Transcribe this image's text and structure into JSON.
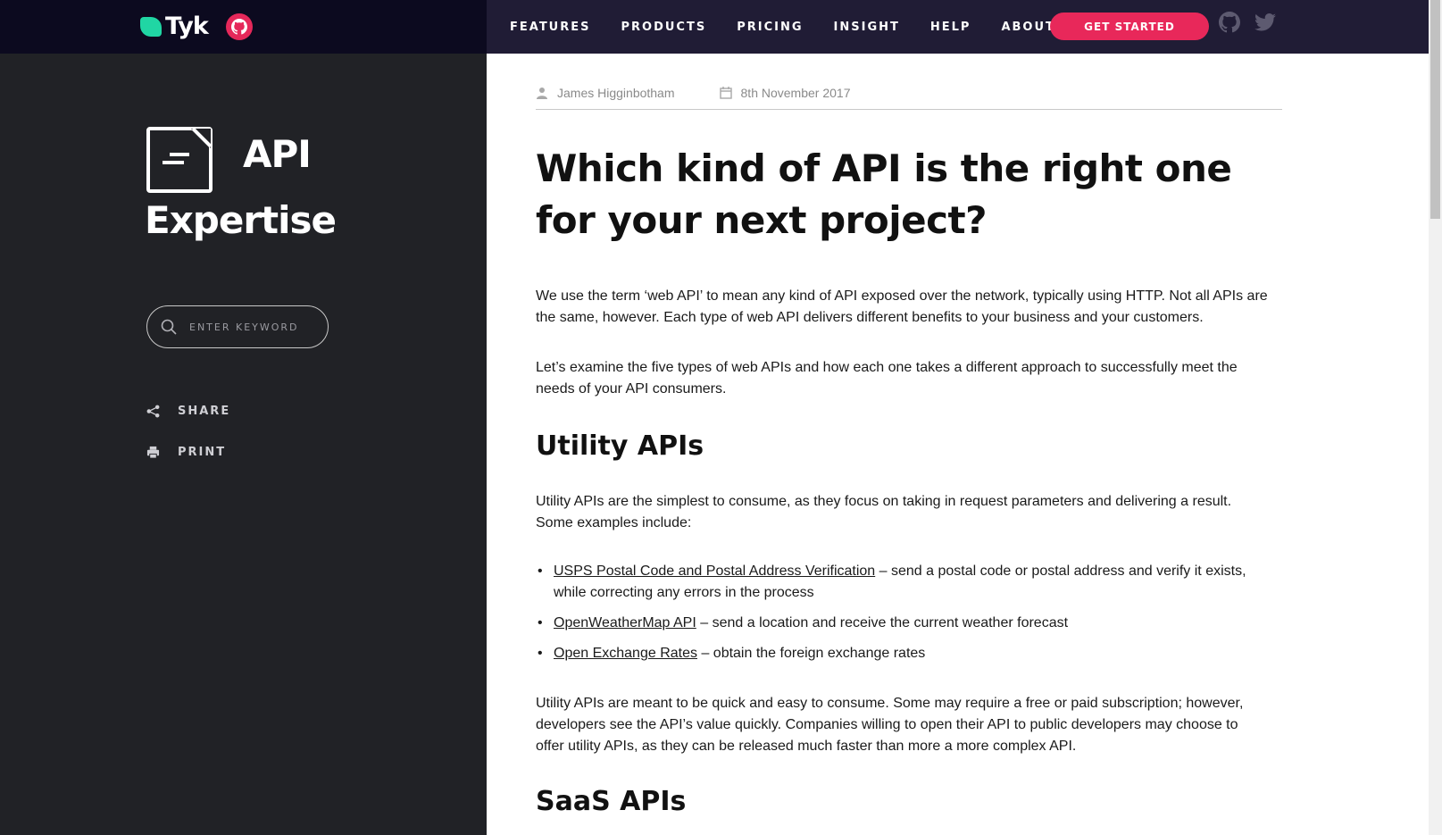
{
  "header": {
    "logo_text": "Tyk",
    "nav": [
      "FEATURES",
      "PRODUCTS",
      "PRICING",
      "INSIGHT",
      "HELP",
      "ABOUT"
    ],
    "cta_label": "GET STARTED"
  },
  "sidebar": {
    "title_line1": "API",
    "title_line2": "Expertise",
    "search_placeholder": "ENTER KEYWORD",
    "share_label": "SHARE",
    "print_label": "PRINT"
  },
  "article": {
    "author": "James Higginbotham",
    "date": "8th November 2017",
    "title": "Which kind of API is the right one for your next project?",
    "intro_1": "We use the term ‘web API’ to mean any kind of API exposed over the network, typically using HTTP. Not all APIs are the same, however. Each type of web API delivers different benefits to your business and your customers.",
    "intro_2": "Let’s examine the five types of web APIs and how each one takes a different approach to successfully meet the needs of your API consumers.",
    "section_1_heading": "Utility APIs",
    "section_1_para": "Utility APIs are the simplest to consume, as they focus on taking in request parameters and delivering a result. Some examples include:",
    "examples": [
      {
        "link": "USPS Postal Code and Postal Address Verification",
        "text": " – send a postal code or postal address and verify it exists, while correcting any errors in the process"
      },
      {
        "link": "OpenWeatherMap API",
        "text": " – send a location and receive the current weather forecast"
      },
      {
        "link": "Open Exchange Rates",
        "text": " – obtain the foreign exchange rates"
      }
    ],
    "section_1_para_2": "Utility APIs are meant to be quick and easy to consume. Some may require a free or paid subscription; however, developers see the API’s value quickly. Companies willing to open their API to public developers may choose to offer utility APIs, as they can be released much faster than more a more complex API.",
    "section_2_heading": "SaaS APIs"
  },
  "colors": {
    "accent": "#e8285a",
    "logo_green": "#20d6a4",
    "sidebar_bg": "#212226",
    "topbar_bg": "#201c35"
  },
  "icons": [
    "logo-icon",
    "github-icon",
    "twitter-icon",
    "search-icon",
    "share-icon",
    "print-icon",
    "user-icon",
    "calendar-icon",
    "api-expertise-icon"
  ]
}
